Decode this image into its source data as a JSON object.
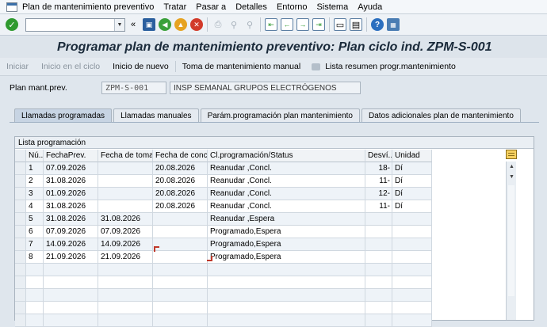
{
  "menubar": {
    "items": [
      "Plan de mantenimiento preventivo",
      "Tratar",
      "Pasar a",
      "Detalles",
      "Entorno",
      "Sistema",
      "Ayuda"
    ]
  },
  "toolbar": {
    "command_value": "",
    "icons": [
      "ok-icon",
      "back-arrows-icon",
      "save-icon",
      "back-icon",
      "exit-icon",
      "cancel-icon",
      "print-icon",
      "find-icon",
      "find-next-icon",
      "first-page-icon",
      "prev-page-icon",
      "next-page-icon",
      "last-page-icon",
      "new-session-icon",
      "shortcut-icon",
      "help-icon",
      "layout-icon"
    ]
  },
  "title": "Programar plan de mantenimiento preventivo: Plan ciclo ind. ZPM-S-001",
  "app_toolbar": {
    "buttons": [
      {
        "label": "Iniciar",
        "enabled": false
      },
      {
        "label": "Inicio en el ciclo",
        "enabled": false
      },
      {
        "label": "Inicio de nuevo",
        "enabled": true
      },
      {
        "label": "Toma de mantenimiento manual",
        "enabled": true
      },
      {
        "label": "Lista resumen progr.mantenimiento",
        "enabled": true
      }
    ]
  },
  "header": {
    "plan_label": "Plan mant.prev.",
    "plan_code": "ZPM-S-001",
    "plan_desc": "INSP SEMANAL GRUPOS ELECTRÓGENOS"
  },
  "tabs": [
    {
      "label": "Llamadas programadas",
      "active": true
    },
    {
      "label": "Llamadas manuales",
      "active": false
    },
    {
      "label": "Parám.programación plan mantenimiento",
      "active": false
    },
    {
      "label": "Datos adicionales plan de mantenimiento",
      "active": false
    }
  ],
  "table": {
    "caption": "Lista programación",
    "columns": [
      "Nú...",
      "FechaPrev.",
      "Fecha de toma",
      "Fecha de concl...",
      "Cl.programación/Status",
      "Desví...",
      "Unidad"
    ],
    "rows": [
      [
        "1",
        "07.09.2026",
        "",
        "20.08.2026",
        "Reanudar  ,Concl.",
        "18-",
        "Dí"
      ],
      [
        "2",
        "31.08.2026",
        "",
        "20.08.2026",
        "Reanudar  ,Concl.",
        "11-",
        "Dí"
      ],
      [
        "3",
        "01.09.2026",
        "",
        "20.08.2026",
        "Reanudar  ,Concl.",
        "12-",
        "Dí"
      ],
      [
        "4",
        "31.08.2026",
        "",
        "20.08.2026",
        "Reanudar  ,Concl.",
        "11-",
        "Dí"
      ],
      [
        "5",
        "31.08.2026",
        "31.08.2026",
        "",
        "Reanudar  ,Espera",
        "",
        ""
      ],
      [
        "6",
        "07.09.2026",
        "07.09.2026",
        "",
        "Programado,Espera",
        "",
        ""
      ],
      [
        "7",
        "14.09.2026",
        "14.09.2026",
        "",
        "Programado,Espera",
        "",
        ""
      ],
      [
        "8",
        "21.09.2026",
        "21.09.2026",
        "",
        "Programado,Espera",
        "",
        ""
      ],
      [
        "",
        "",
        "",
        "",
        "",
        "",
        ""
      ],
      [
        "",
        "",
        "",
        "",
        "",
        "",
        ""
      ],
      [
        "",
        "",
        "",
        "",
        "",
        "",
        ""
      ],
      [
        "",
        "",
        "",
        "",
        "",
        "",
        ""
      ],
      [
        "",
        "",
        "",
        "",
        "",
        "",
        ""
      ]
    ]
  }
}
